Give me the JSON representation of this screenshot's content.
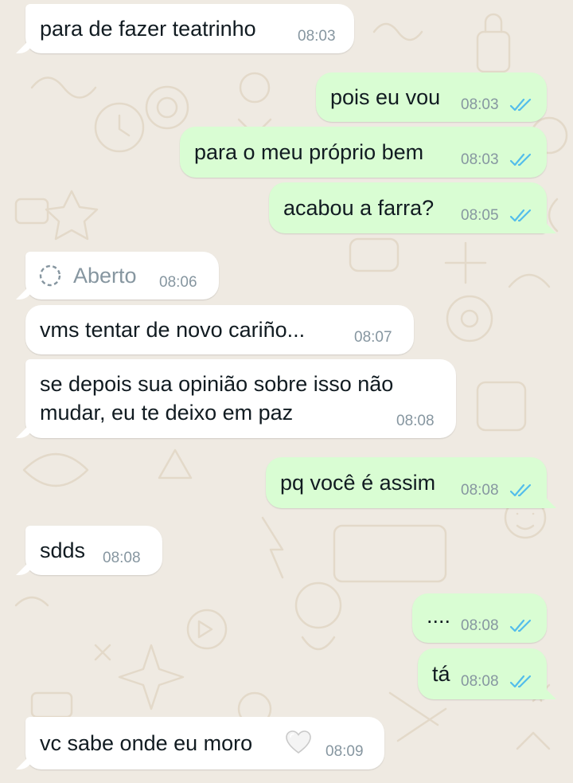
{
  "colors": {
    "background": "#efeae2",
    "incoming_bubble": "#ffffff",
    "outgoing_bubble": "#d9fdd3",
    "timestamp": "#8696a0",
    "read_ticks": "#53bdeb"
  },
  "messages": [
    {
      "direction": "incoming",
      "text": "para de fazer teatrinho",
      "time": "08:03"
    },
    {
      "direction": "outgoing",
      "text": "pois eu vou",
      "time": "08:03",
      "status": "read"
    },
    {
      "direction": "outgoing",
      "text": "para o meu próprio bem",
      "time": "08:03",
      "status": "read"
    },
    {
      "direction": "outgoing",
      "text": "acabou a farra?",
      "time": "08:05",
      "status": "read"
    },
    {
      "direction": "incoming",
      "text": "Aberto",
      "time": "08:06",
      "icon": "view-once-opened-icon"
    },
    {
      "direction": "incoming",
      "text": "vms tentar de novo cariño...",
      "time": "08:07"
    },
    {
      "direction": "incoming",
      "text_lines": [
        "se depois sua opinião sobre isso não",
        "mudar, eu te deixo em paz"
      ],
      "time": "08:08"
    },
    {
      "direction": "outgoing",
      "text": "pq você é assim",
      "time": "08:08",
      "status": "read"
    },
    {
      "direction": "incoming",
      "text": "sdds",
      "time": "08:08"
    },
    {
      "direction": "outgoing",
      "text": "....",
      "time": "08:08",
      "status": "read"
    },
    {
      "direction": "outgoing",
      "text": "tá",
      "time": "08:08",
      "status": "read"
    },
    {
      "direction": "incoming",
      "text": "vc sabe onde eu moro",
      "time": "08:09",
      "icon": "white-heart-emoji"
    }
  ]
}
